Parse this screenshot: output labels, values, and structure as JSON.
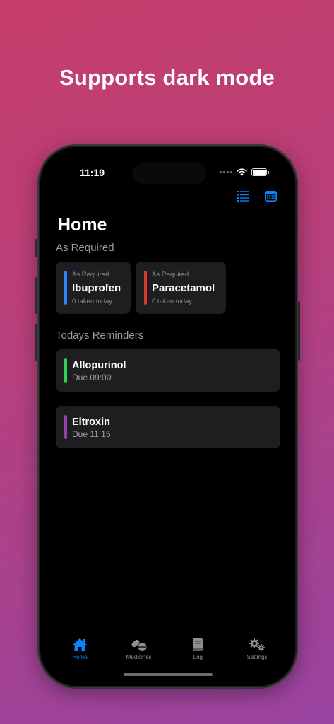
{
  "headline": "Supports dark mode",
  "status": {
    "time": "11:19"
  },
  "home": {
    "title": "Home",
    "as_required_label": "As Required",
    "as_required": [
      {
        "caption": "As Required",
        "name": "Ibuprofen",
        "sub": "0 taken today",
        "color": "#2f86f6"
      },
      {
        "caption": "As Required",
        "name": "Paracetamol",
        "sub": "0 taken today",
        "color": "#d83a2f"
      }
    ],
    "reminders_label": "Todays Reminders",
    "reminders": [
      {
        "name": "Allopurinol",
        "due": "Due 09:00",
        "color": "#30d158"
      },
      {
        "name": "Eltroxin",
        "due": "Due 11:15",
        "color": "#8e44ad"
      }
    ]
  },
  "tabs": [
    {
      "label": "Home",
      "icon": "house-icon",
      "active": true
    },
    {
      "label": "Medicines",
      "icon": "pills-icon",
      "active": false
    },
    {
      "label": "Log",
      "icon": "book-icon",
      "active": false
    },
    {
      "label": "Settings",
      "icon": "gears-icon",
      "active": false
    }
  ],
  "colors": {
    "accent": "#0a84ff",
    "card_bg": "#1e1e20"
  }
}
